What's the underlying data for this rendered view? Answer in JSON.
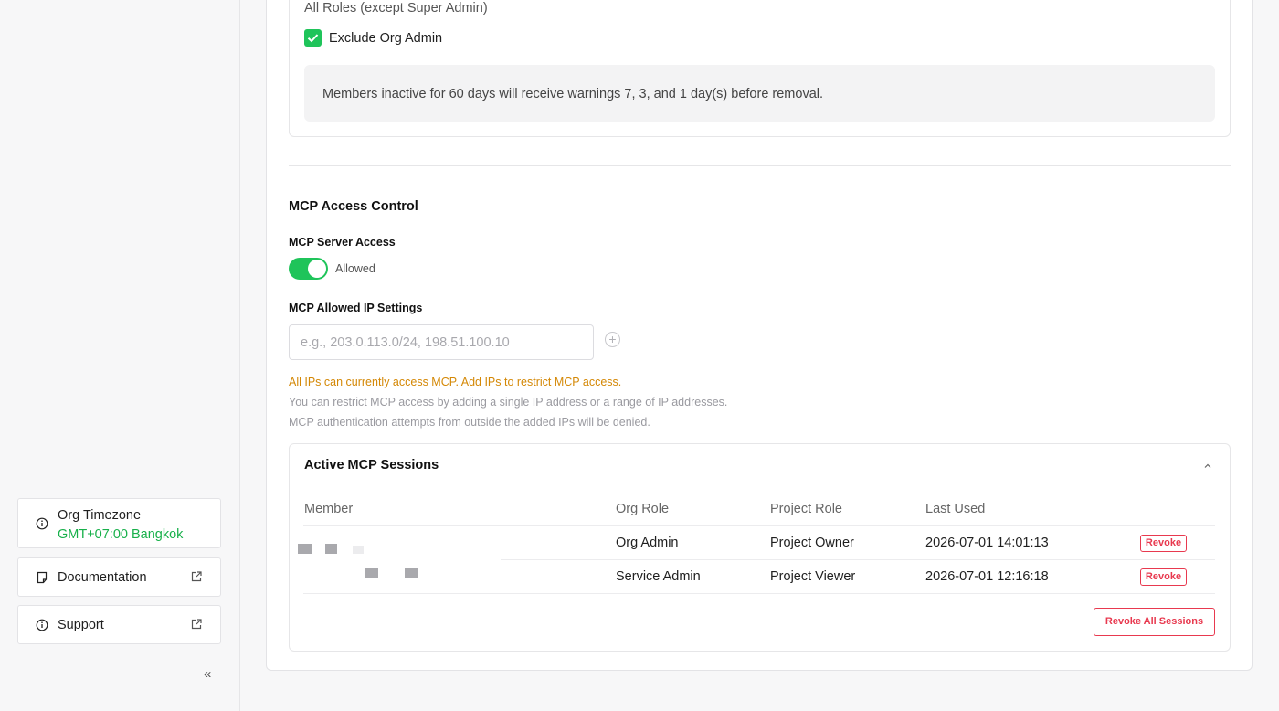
{
  "sidebar": {
    "org_timezone": {
      "label": "Org Timezone",
      "value": "GMT+07:00 Bangkok",
      "icon": "info-circle-icon"
    },
    "documentation": {
      "label": "Documentation",
      "icon": "document-icon",
      "ext_icon": "external-link-icon"
    },
    "support": {
      "label": "Support",
      "icon": "info-circle-icon",
      "ext_icon": "external-link-icon"
    },
    "collapse": "«"
  },
  "inactivity": {
    "roles_text": "All Roles (except Super Admin)",
    "exclude_org_admin": {
      "label": "Exclude Org Admin",
      "checked": true
    },
    "note": "Members inactive for 60 days will receive warnings 7, 3, and 1 day(s) before removal."
  },
  "mcp": {
    "title": "MCP Access Control",
    "server_access": {
      "label": "MCP Server Access",
      "enabled": true,
      "state_text": "Allowed"
    },
    "ip_settings": {
      "label": "MCP Allowed IP Settings",
      "placeholder": "e.g., 203.0.113.0/24, 198.51.100.10",
      "value": "",
      "add_icon": "plus-circle-icon"
    },
    "warning": "All IPs can currently access MCP. Add IPs to restrict MCP access.",
    "help_1": "You can restrict MCP access by adding a single IP address or a range of IP addresses.",
    "help_2": "MCP authentication attempts from outside the added IPs will be denied."
  },
  "sessions": {
    "title": "Active MCP Sessions",
    "collapse_icon": "chevron-up-icon",
    "columns": [
      "Member",
      "Org Role",
      "Project Role",
      "Last Used"
    ],
    "rows": [
      {
        "org_role": "Org Admin",
        "project_role": "Project Owner",
        "last_used": "2026-07-01 14:01:13",
        "action": "Revoke"
      },
      {
        "org_role": "Service Admin",
        "project_role": "Project Viewer",
        "last_used": "2026-07-01 12:16:18",
        "action": "Revoke"
      }
    ],
    "revoke_all": "Revoke All Sessions"
  },
  "colors": {
    "accent_green": "#1fc45a",
    "timezone_green": "#17b04a",
    "danger": "#e8394f",
    "warning": "#d48806"
  }
}
